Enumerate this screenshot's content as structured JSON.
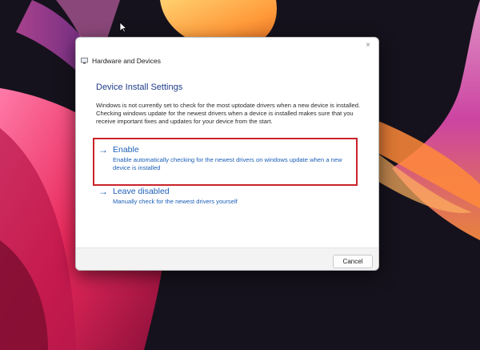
{
  "window": {
    "title": "Hardware and Devices",
    "close_glyph": "×"
  },
  "content": {
    "heading": "Device Install Settings",
    "description": "Windows is not currently set to check for the most uptodate drivers when a new device is installed. Checking windows update for the newest drivers when a device is installed makes sure that you receive important fixes and updates for your device from the start."
  },
  "options": [
    {
      "arrow": "→",
      "label": "Enable",
      "description": "Enable automatically checking for the newest drivers on windows update when a new device is installed",
      "highlighted": true
    },
    {
      "arrow": "→",
      "label": "Leave disabled",
      "description": "Manually check for the newest drivers yourself",
      "highlighted": false
    }
  ],
  "footer": {
    "cancel_label": "Cancel"
  },
  "colors": {
    "link": "#1c5fb8",
    "heading": "#1f3d8a",
    "highlight_box": "#c9232a",
    "desktop_bg": "#15111c"
  },
  "icons": {
    "window_icon": "hardware-devices-icon",
    "cursor": "mouse-pointer-icon",
    "close": "close-icon",
    "option_arrow": "arrow-right-icon"
  }
}
